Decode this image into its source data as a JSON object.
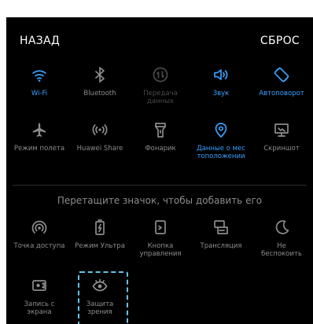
{
  "header": {
    "back_label": "НАЗАД",
    "reset_label": "СБРОС"
  },
  "colors": {
    "active": "#3aa0ff",
    "inactive": "#8c8c8c",
    "disabled": "#4a4a4a",
    "background": "#000000",
    "highlight": "#62c3e8"
  },
  "active_tiles": [
    {
      "label": "Wi-Fi",
      "icon": "wifi-icon",
      "state": "active"
    },
    {
      "label": "Bluetooth",
      "icon": "bluetooth-icon",
      "state": "inactive"
    },
    {
      "label": "Передача\nданных",
      "icon": "mobile-data-icon",
      "state": "disabled"
    },
    {
      "label": "Звук",
      "icon": "sound-icon",
      "state": "active"
    },
    {
      "label": "Автоповорот",
      "icon": "auto-rotate-icon",
      "state": "active"
    },
    {
      "label": "Режим полета",
      "icon": "airplane-icon",
      "state": "inactive"
    },
    {
      "label": "Huawei Share",
      "icon": "huawei-share-icon",
      "state": "inactive"
    },
    {
      "label": "Фонарик",
      "icon": "flashlight-icon",
      "state": "inactive"
    },
    {
      "label": "Данные о мес\nтоположении",
      "icon": "location-icon",
      "state": "active"
    },
    {
      "label": "Скриншот",
      "icon": "screenshot-icon",
      "state": "inactive"
    }
  ],
  "hint_text": "Перетащите значок, чтобы добавить его",
  "available_tiles": [
    {
      "label": "Точка доступа",
      "icon": "hotspot-icon"
    },
    {
      "label": "Режим Ультра",
      "icon": "ultra-battery-icon"
    },
    {
      "label": "Кнопка\nуправления",
      "icon": "navigation-dock-icon"
    },
    {
      "label": "Трансляция",
      "icon": "cast-icon"
    },
    {
      "label": "Не\nбеспокоить",
      "icon": "do-not-disturb-icon"
    },
    {
      "label": "Запись с\nэкрана",
      "icon": "screen-record-icon"
    },
    {
      "label": "Защита\nзрения",
      "icon": "eye-comfort-icon"
    }
  ]
}
